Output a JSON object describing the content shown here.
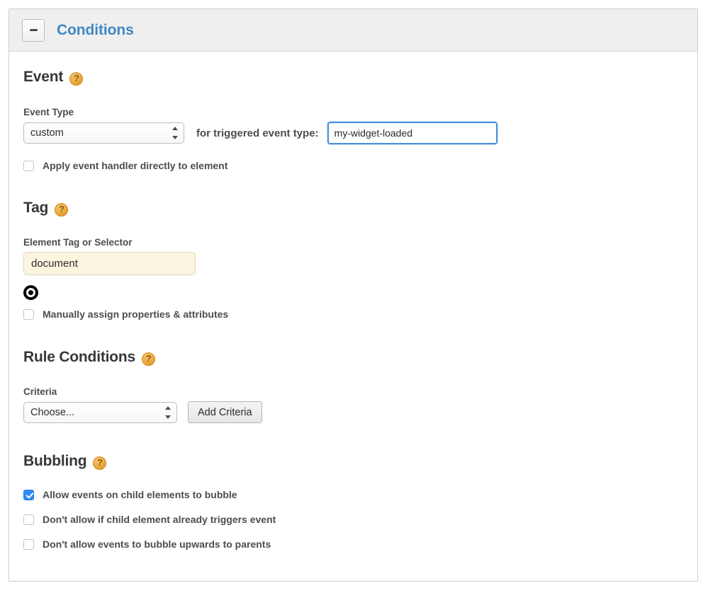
{
  "panel": {
    "title": "Conditions",
    "collapse_icon": "minus-icon",
    "collapse_label": "-"
  },
  "event": {
    "heading": "Event",
    "help_icon": "question-mark-icon",
    "help_label": "?",
    "event_type_label": "Event Type",
    "event_type_value": "custom",
    "event_type_options": [
      "custom"
    ],
    "trigger_label": "for triggered event type:",
    "trigger_value": "my-widget-loaded",
    "apply_directly_label": "Apply event handler directly to element",
    "apply_directly_checked": false
  },
  "tag": {
    "heading": "Tag",
    "help_icon": "question-mark-icon",
    "help_label": "?",
    "selector_label": "Element Tag or Selector",
    "selector_value": "document",
    "target_icon": "target-radio-icon",
    "manual_assign_label": "Manually assign properties & attributes",
    "manual_assign_checked": false
  },
  "rule_conditions": {
    "heading": "Rule Conditions",
    "help_icon": "question-mark-icon",
    "help_label": "?",
    "criteria_label": "Criteria",
    "criteria_value": "Choose...",
    "criteria_options": [
      "Choose..."
    ],
    "add_button_label": "Add Criteria"
  },
  "bubbling": {
    "heading": "Bubbling",
    "help_icon": "question-mark-icon",
    "help_label": "?",
    "options": [
      {
        "label": "Allow events on child elements to bubble",
        "checked": true
      },
      {
        "label": "Don't allow if child element already triggers event",
        "checked": false
      },
      {
        "label": "Don't allow events to bubble upwards to parents",
        "checked": false
      }
    ]
  },
  "colors": {
    "accent_blue": "#3f87c4",
    "checkbox_blue": "#2d8cf5",
    "help_orange": "#edaa3f",
    "tag_field_bg": "#fbf5e0",
    "header_bg": "#efefef"
  }
}
